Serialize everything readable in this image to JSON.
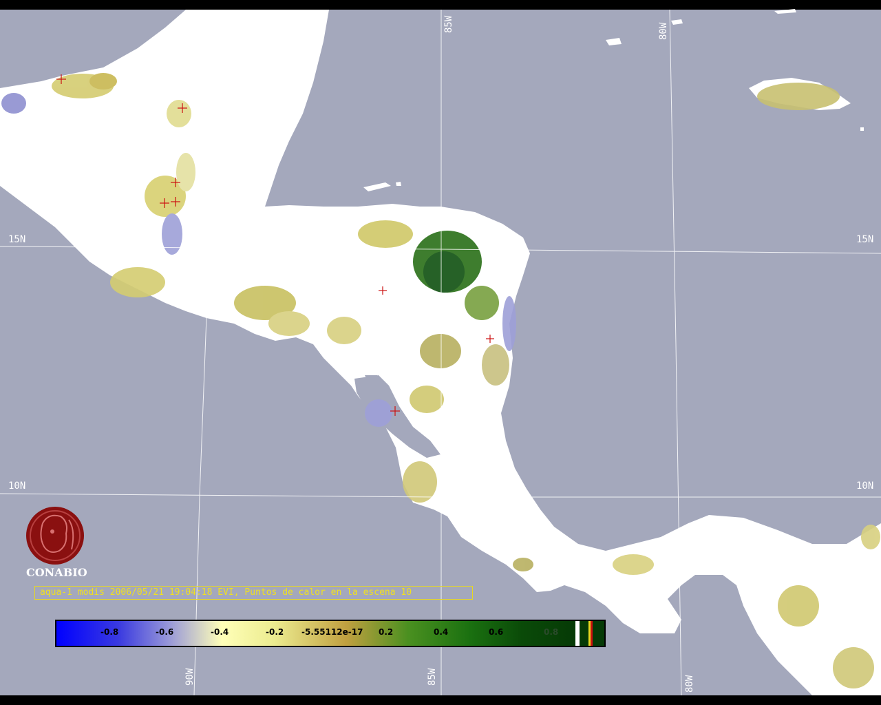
{
  "caption": "aqua-1 modis 2006/05/21 19:04:18 EVI, Puntos de calor en la escena 10",
  "logo": {
    "text": "CONABIO",
    "icon": "conabio-logo-icon"
  },
  "grid_labels": {
    "lat_15_left": "15N",
    "lat_15_right": "15N",
    "lat_10_left": "10N",
    "lat_10_right": "10N",
    "lon_85_top": "85W",
    "lon_80_top": "80W",
    "lon_90_bottom": "90W",
    "lon_85_bottom": "85W",
    "lon_80_bottom": "80W"
  },
  "colorbar": {
    "ticks": [
      "-0.8",
      "-0.6",
      "-0.4",
      "-0.2",
      "-5.55112e-17",
      "0.2",
      "0.4",
      "0.6",
      "0.8"
    ]
  },
  "colors": {
    "ocean": "#a4a8bc",
    "land": "#ffffff",
    "grid": "#ffffff",
    "hotspot": "#cc1010",
    "logo": "#8a1010",
    "caption": "#f0e020"
  }
}
